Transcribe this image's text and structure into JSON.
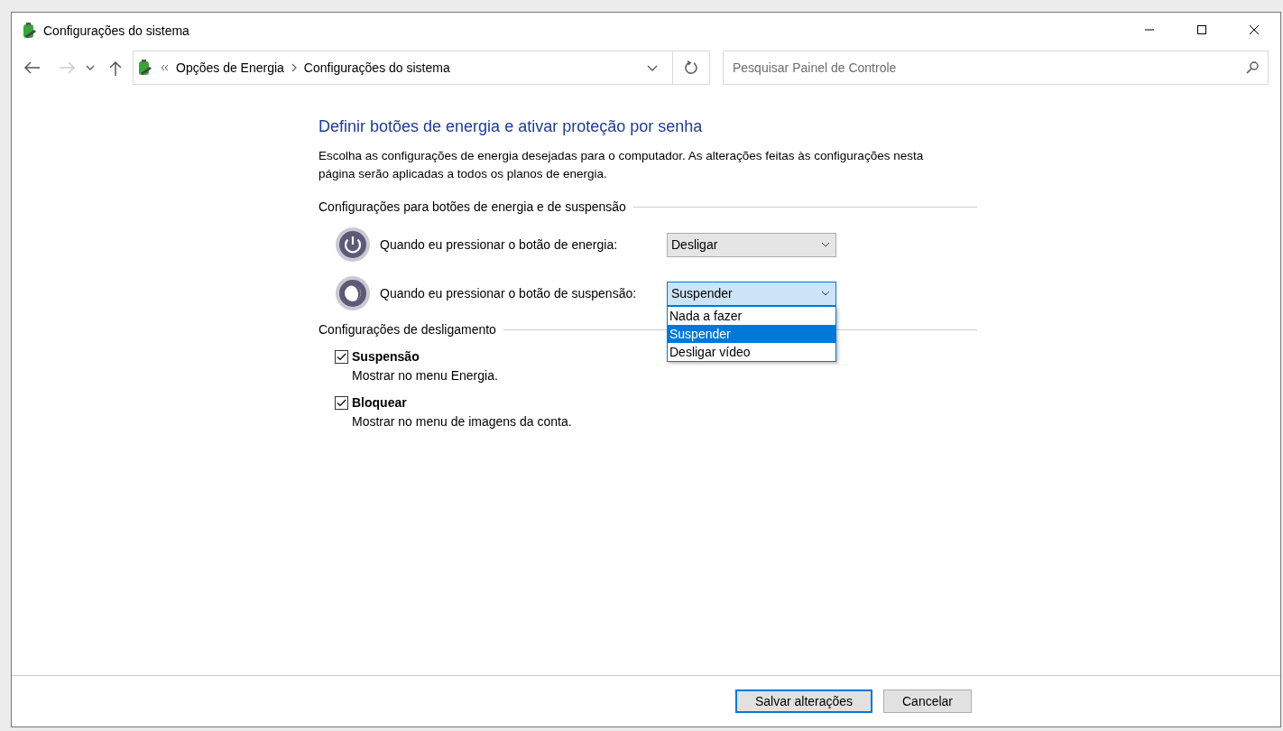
{
  "window": {
    "title": "Configurações do sistema"
  },
  "address_bar": {
    "breadcrumb": [
      "Opções de Energia",
      "Configurações do sistema"
    ]
  },
  "search": {
    "placeholder": "Pesquisar Painel de Controle"
  },
  "page": {
    "heading": "Definir botões de energia e ativar proteção por senha",
    "description": "Escolha as configurações de energia desejadas para o computador. As alterações feitas às configurações nesta página serão aplicadas a todos os planos de energia."
  },
  "power_buttons": {
    "title": "Configurações para botões de energia e de suspensão",
    "rows": [
      {
        "kind": "power",
        "label": "Quando eu pressionar o botão de energia:",
        "value": "Desligar",
        "open": false,
        "options": []
      },
      {
        "kind": "sleep",
        "label": "Quando eu pressionar o botão de suspensão:",
        "value": "Suspender",
        "open": true,
        "options": [
          {
            "label": "Nada a fazer",
            "selected": false
          },
          {
            "label": "Suspender",
            "selected": true
          },
          {
            "label": "Desligar vídeo",
            "selected": false
          }
        ]
      }
    ]
  },
  "shutdown": {
    "title": "Configurações de desligamento",
    "options": [
      {
        "label": "Suspensão",
        "description": "Mostrar no menu Energia.",
        "checked": true
      },
      {
        "label": "Bloquear",
        "description": "Mostrar no menu de imagens da conta.",
        "checked": true
      }
    ]
  },
  "buttons": [
    {
      "label": "Salvar alterações",
      "default": true
    },
    {
      "label": "Cancelar",
      "default": false
    }
  ]
}
